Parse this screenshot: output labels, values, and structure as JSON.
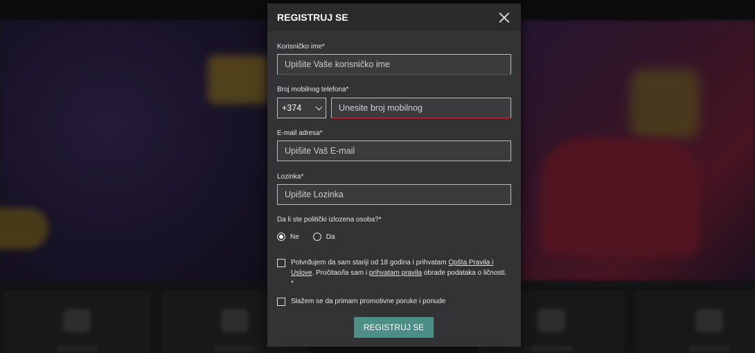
{
  "modal": {
    "title": "REGISTRUJ SE",
    "fields": {
      "username": {
        "label": "Korisničko ime*",
        "placeholder": "Upišite Vaše korisničko ime"
      },
      "phone": {
        "label": "Broj mobilnog telefona*",
        "code": "+374",
        "placeholder": "Unesite broj mobilnog"
      },
      "email": {
        "label": "E-mail adresa*",
        "placeholder": "Upišite Vaš E-mail"
      },
      "password": {
        "label": "Lozinka*",
        "placeholder": "Upišite Lozinka"
      }
    },
    "pep": {
      "question": "Da li ste politički izlozena osoba?*",
      "options": [
        "Ne",
        "Da"
      ],
      "selected": "Ne"
    },
    "terms": {
      "prefix": "Potvrđujem da sam stariji od 18 godina i prihvatam ",
      "link1": "Opšta Pravila i Uslove",
      "middle": ". Pročitao/la sam i ",
      "link2": "prihvatam pravila",
      "suffix": " obrade podataka o ličnosti.",
      "required_mark": "*"
    },
    "promo": "Slažem se da primam promotivne poruke i ponude",
    "submit_label": "REGISTRUJ SE"
  },
  "colors": {
    "accent": "#4d8f85",
    "error": "#d0262f",
    "modal_bg": "#333335"
  }
}
